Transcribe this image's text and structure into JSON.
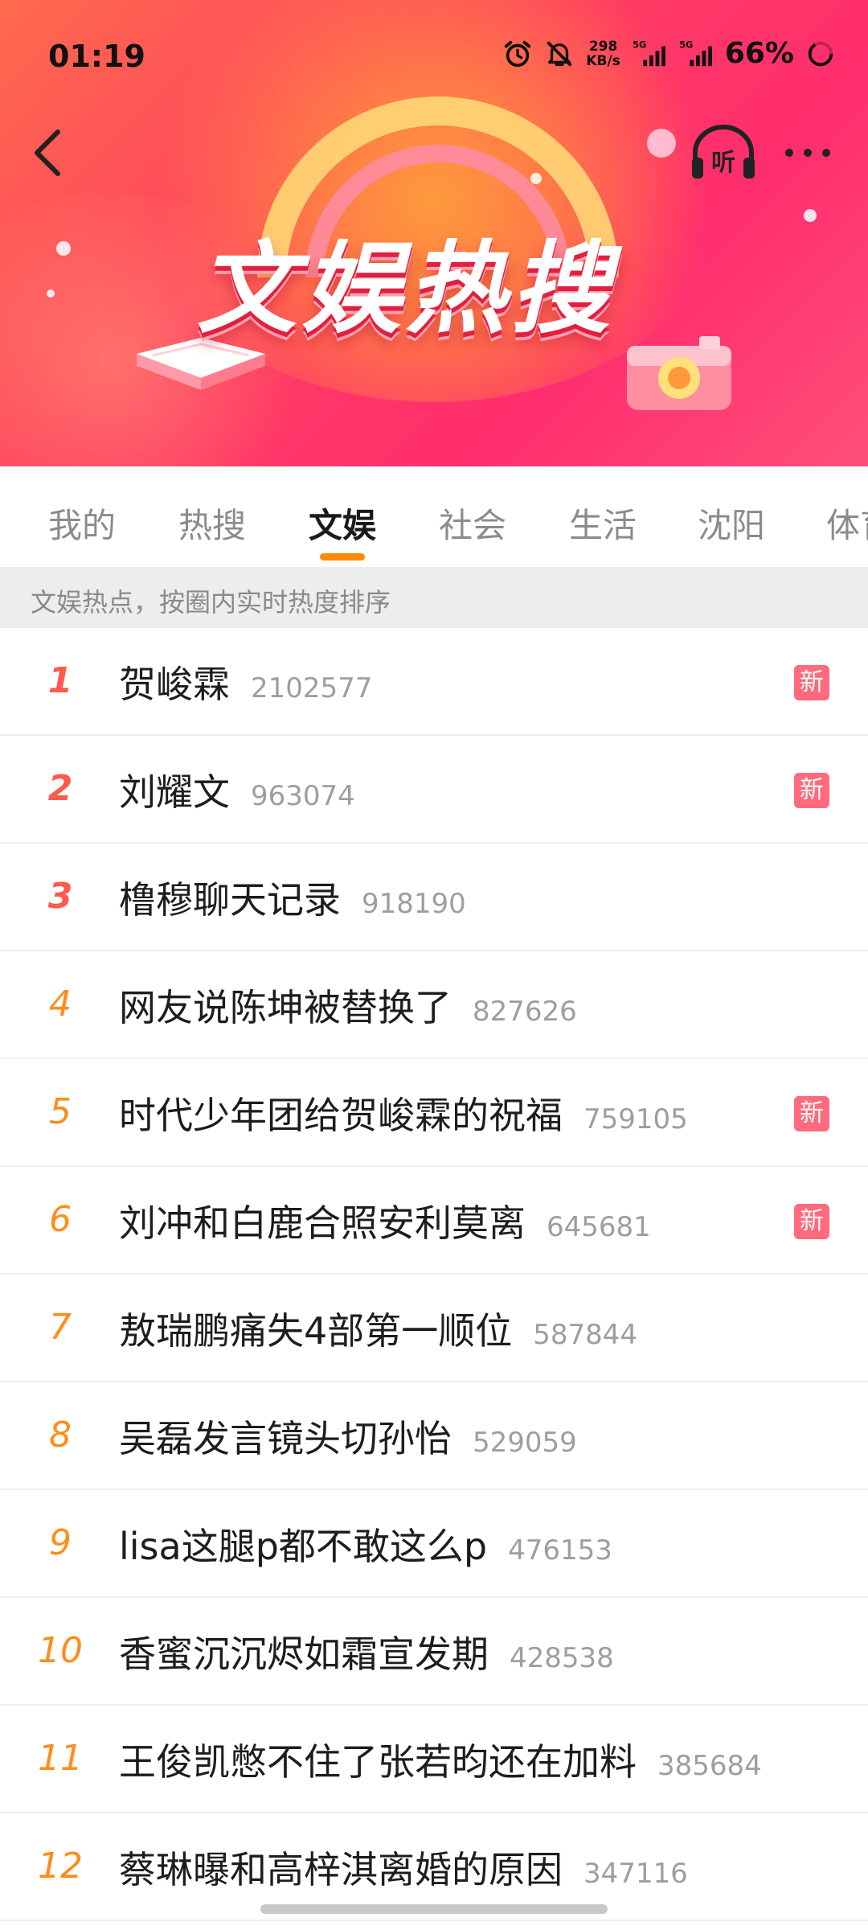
{
  "status_bar": {
    "time": "01:19",
    "speed_value": "298",
    "speed_unit": "KB/s",
    "net1": "5G",
    "net2": "5G",
    "battery": "66%"
  },
  "hero": {
    "title": "文娱热搜",
    "listen_label": "听"
  },
  "tabs": [
    {
      "label": "我的"
    },
    {
      "label": "热搜"
    },
    {
      "label": "文娱"
    },
    {
      "label": "社会"
    },
    {
      "label": "生活"
    },
    {
      "label": "沈阳"
    },
    {
      "label": "体育"
    }
  ],
  "active_tab": "文娱",
  "subheader": "文娱热点，按圈内实时热度排序",
  "badge_label": "新",
  "colors": {
    "accent": "#ff8a00",
    "rank_top": "#ff5a4e",
    "rank_other": "#ff8d1a",
    "badge_new": "#ff6a7d"
  },
  "items": [
    {
      "rank": "1",
      "topic": "贺峻霖",
      "heat": "2102577",
      "new": true
    },
    {
      "rank": "2",
      "topic": "刘耀文",
      "heat": "963074",
      "new": true
    },
    {
      "rank": "3",
      "topic": "橹穆聊天记录",
      "heat": "918190",
      "new": false
    },
    {
      "rank": "4",
      "topic": "网友说陈坤被替换了",
      "heat": "827626",
      "new": false
    },
    {
      "rank": "5",
      "topic": "时代少年团给贺峻霖的祝福",
      "heat": "759105",
      "new": true
    },
    {
      "rank": "6",
      "topic": "刘冲和白鹿合照安利莫离",
      "heat": "645681",
      "new": true
    },
    {
      "rank": "7",
      "topic": "敖瑞鹏痛失4部第一顺位",
      "heat": "587844",
      "new": false
    },
    {
      "rank": "8",
      "topic": "吴磊发言镜头切孙怡",
      "heat": "529059",
      "new": false
    },
    {
      "rank": "9",
      "topic": "lisa这腿p都不敢这么p",
      "heat": "476153",
      "new": false
    },
    {
      "rank": "10",
      "topic": "香蜜沉沉烬如霜宣发期",
      "heat": "428538",
      "new": false
    },
    {
      "rank": "11",
      "topic": "王俊凯憋不住了张若昀还在加料",
      "heat": "385684",
      "new": false
    },
    {
      "rank": "12",
      "topic": "蔡琳曝和高梓淇离婚的原因",
      "heat": "347116",
      "new": false
    }
  ]
}
